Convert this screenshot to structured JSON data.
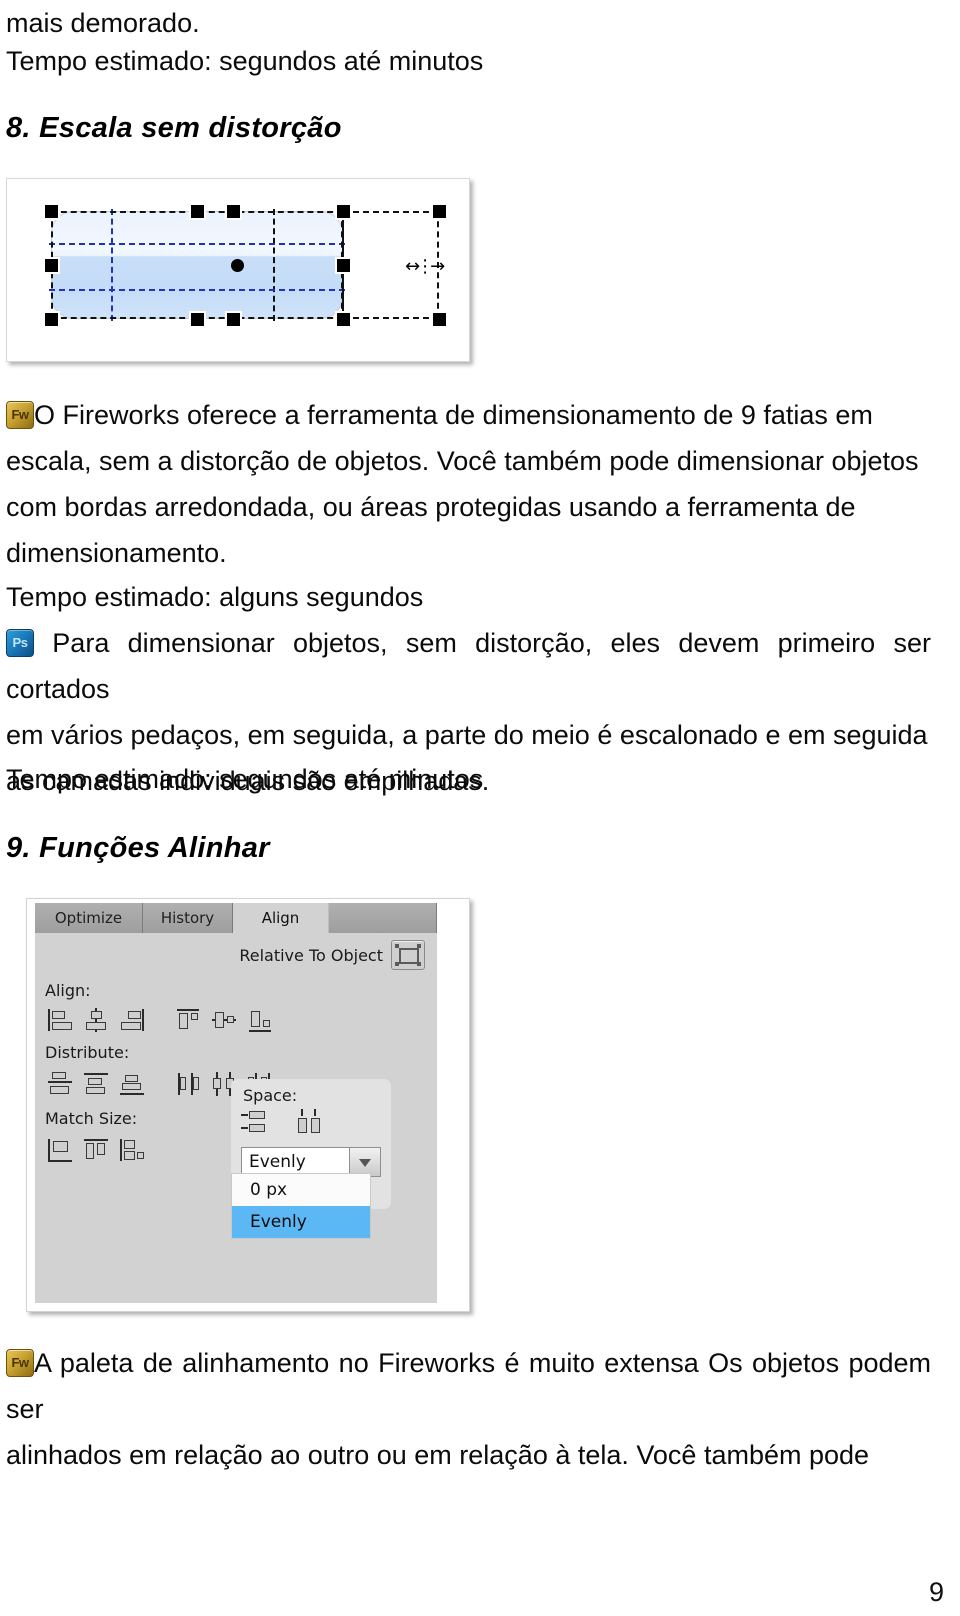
{
  "document": {
    "page_number": "9",
    "language": "pt-BR"
  },
  "blocks": {
    "intro_line1": "mais demorado.",
    "intro_line2": "Tempo estimado: segundos até minutos",
    "heading_8": "8. Escala sem distorção",
    "fw_para_1": {
      "icon": "fireworks-icon",
      "icon_label": "Fw",
      "line1": "O  Fireworks  oferece  a  ferramenta  de  dimensionamento  de  9  fatias  em",
      "line2": "escala,  sem  a  distorção  de  objetos.  Você  também  pode  dimensionar  objetos",
      "line3": "com   bordas   arredondada,   ou   áreas   protegidas   usando   a   ferramenta   de",
      "line4": "dimensionamento."
    },
    "time_1": "Tempo estimado: alguns segundos",
    "ps_para": {
      "icon": "photoshop-icon",
      "icon_label": "Ps",
      "line1": "Para dimensionar objetos, sem distorção, eles devem primeiro ser cortados",
      "line2": "em  vários  pedaços,  em  seguida,  a  parte  do  meio  é  escalonado  e  em  seguida",
      "line3": "as camadas individuais são empilhadas."
    },
    "time_2": "Tempo estimado: segundos até minutos",
    "heading_9": "9. Funções Alinhar",
    "fw_para_2": {
      "icon": "fireworks-icon",
      "icon_label": "Fw",
      "line1": "A paleta de alinhamento no Fireworks é muito extensa Os objetos podem ser",
      "line2": "alinhados  em  relação  ao  outro  ou  em  relação  à  tela.  Você  também  pode"
    }
  },
  "figure_scale": {
    "name": "9-slice-scaling-illustration",
    "shape_fill_top": "#eaf2fd",
    "shape_fill_bottom": "#c4dcf7",
    "guide_color": "#2233bb",
    "selection_color": "#111111",
    "cursor": "horizontal-resize-cursor"
  },
  "figure_align": {
    "name": "fireworks-align-panel",
    "tabs": [
      {
        "label": "Optimize",
        "active": false
      },
      {
        "label": "History",
        "active": false
      },
      {
        "label": "Align",
        "active": true
      }
    ],
    "relative_to": {
      "label": "Relative To Object",
      "button": "relative-to-object-toggle"
    },
    "groups": [
      {
        "label": "Align:",
        "icons": [
          "align-left-icon",
          "align-center-horizontal-icon",
          "align-right-icon",
          "align-top-icon",
          "align-middle-vertical-icon",
          "align-bottom-icon"
        ]
      },
      {
        "label": "Distribute:",
        "icons": [
          "distribute-top-icon",
          "distribute-center-vertical-icon",
          "distribute-bottom-icon",
          "distribute-left-icon",
          "distribute-center-horizontal-icon",
          "distribute-right-icon"
        ]
      },
      {
        "label": "Match Size:",
        "icons": [
          "match-width-icon",
          "match-height-icon",
          "match-both-icon"
        ]
      }
    ],
    "space_group": {
      "label": "Space:",
      "icons": [
        "space-horizontal-icon",
        "space-vertical-icon"
      ],
      "combo_value": "Evenly",
      "combo_arrow": "chevron-down-icon",
      "options": [
        {
          "label": "0 px",
          "selected": false
        },
        {
          "label": "Evenly",
          "selected": true
        }
      ],
      "highlight_color": "#5cb8f5"
    }
  }
}
